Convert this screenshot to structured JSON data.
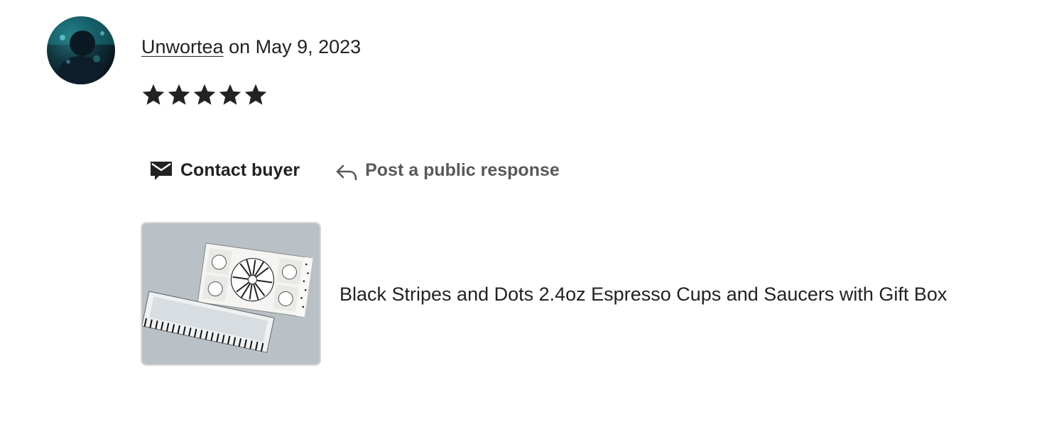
{
  "review": {
    "username": "Unwortea",
    "date_text": " on May 9, 2023",
    "rating": 5,
    "rating_max": 5
  },
  "actions": {
    "contact_label": "Contact buyer",
    "respond_label": "Post a public response"
  },
  "listing": {
    "title": "Black Stripes and Dots 2.4oz Espresso Cups and Saucers with Gift Box"
  },
  "icons": {
    "contact": "envelope-icon",
    "respond": "reply-arrow-icon",
    "star": "star-icon"
  },
  "colors": {
    "text": "#222222",
    "muted": "#595959",
    "thumb_bg": "#b9c0c6"
  }
}
